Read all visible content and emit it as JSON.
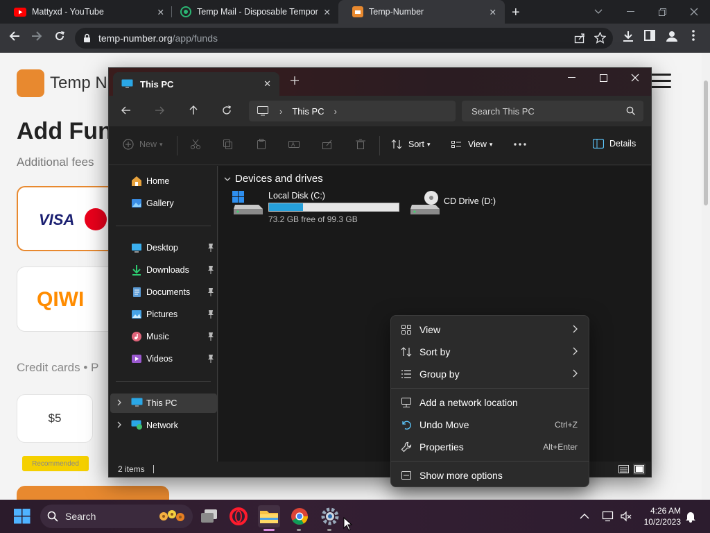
{
  "browser": {
    "tabs": [
      {
        "title": "Mattyxd - YouTube",
        "icon": "youtube-icon",
        "color": "#ff0000"
      },
      {
        "title": "Temp Mail - Disposable Tempora",
        "icon": "tempmail-icon",
        "color": "#2bb673"
      },
      {
        "title": "Temp-Number",
        "icon": "tempnumber-icon",
        "color": "#e8892f"
      }
    ],
    "url_host": "temp-number.org",
    "url_path": "/app/funds"
  },
  "webpage": {
    "brand": "Temp N",
    "title": "Add Fun",
    "subtitle": "Additional fees",
    "visa": "VISA",
    "qiwi": "QIWI",
    "cc_text": "Credit cards • P",
    "amount": "$5",
    "badge": "Recommended"
  },
  "explorer": {
    "tab_title": "This PC",
    "address": "This PC",
    "search_placeholder": "Search This PC",
    "commands": {
      "new": "New",
      "sort": "Sort",
      "view": "View",
      "details": "Details"
    },
    "sidebar": {
      "top": [
        {
          "label": "Home",
          "icon": "home-icon"
        },
        {
          "label": "Gallery",
          "icon": "gallery-icon"
        }
      ],
      "pinned": [
        {
          "label": "Desktop",
          "icon": "desktop-icon"
        },
        {
          "label": "Downloads",
          "icon": "downloads-icon"
        },
        {
          "label": "Documents",
          "icon": "documents-icon"
        },
        {
          "label": "Pictures",
          "icon": "pictures-icon"
        },
        {
          "label": "Music",
          "icon": "music-icon"
        },
        {
          "label": "Videos",
          "icon": "videos-icon"
        }
      ],
      "bottom": [
        {
          "label": "This PC",
          "icon": "this-pc-icon"
        },
        {
          "label": "Network",
          "icon": "network-icon"
        }
      ]
    },
    "group_header": "Devices and drives",
    "drives": [
      {
        "name": "Local Disk (C:)",
        "free": "73.2 GB free of 99.3 GB",
        "used_fraction": 0.26
      },
      {
        "name": "CD Drive (D:)"
      }
    ],
    "status": "2 items"
  },
  "context_menu": {
    "items": [
      {
        "label": "View",
        "icon": "grid-icon",
        "submenu": true
      },
      {
        "label": "Sort by",
        "icon": "sort-icon",
        "submenu": true
      },
      {
        "label": "Group by",
        "icon": "group-icon",
        "submenu": true
      },
      {
        "label": "Add a network location",
        "icon": "network-location-icon"
      },
      {
        "label": "Undo Move",
        "icon": "undo-icon",
        "shortcut": "Ctrl+Z"
      },
      {
        "label": "Properties",
        "icon": "wrench-icon",
        "shortcut": "Alt+Enter"
      },
      {
        "label": "Show more options",
        "icon": "more-options-icon"
      }
    ]
  },
  "taskbar": {
    "search": "Search",
    "time": "4:26 AM",
    "date": "10/2/2023"
  }
}
